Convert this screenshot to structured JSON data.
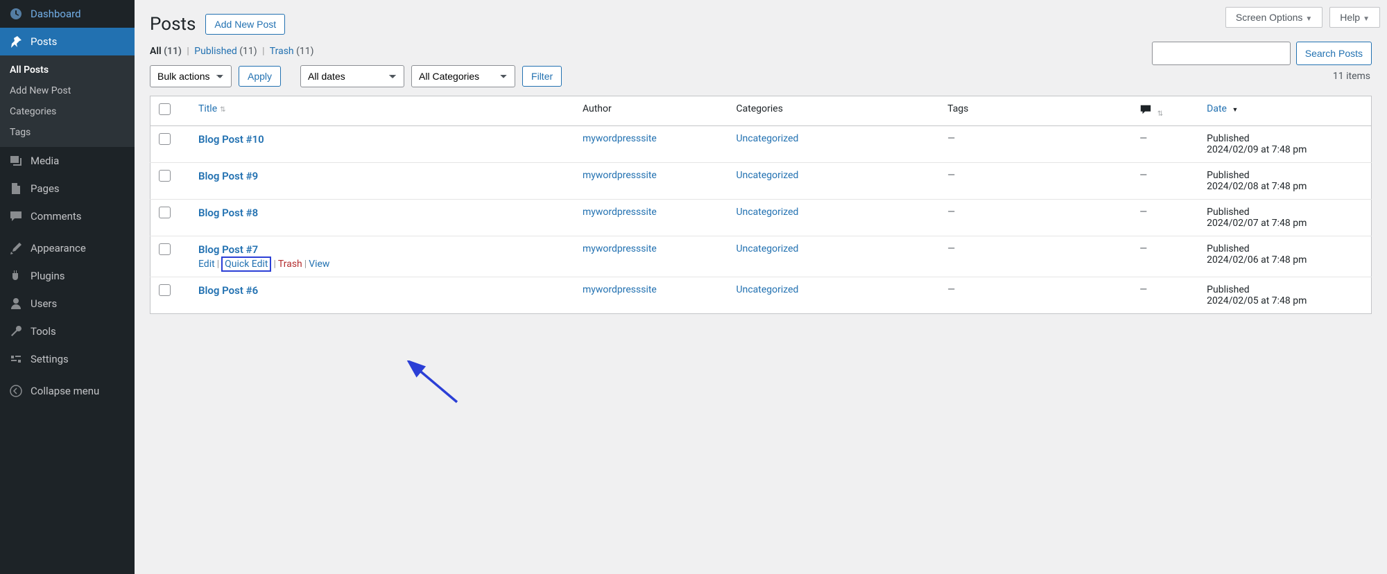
{
  "sidebar": {
    "items": [
      {
        "label": "Dashboard",
        "icon": "dashboard"
      },
      {
        "label": "Posts",
        "icon": "pin",
        "active": true
      },
      {
        "label": "Media",
        "icon": "media"
      },
      {
        "label": "Pages",
        "icon": "page"
      },
      {
        "label": "Comments",
        "icon": "comment"
      },
      {
        "label": "Appearance",
        "icon": "brush"
      },
      {
        "label": "Plugins",
        "icon": "plugin"
      },
      {
        "label": "Users",
        "icon": "user"
      },
      {
        "label": "Tools",
        "icon": "wrench"
      },
      {
        "label": "Settings",
        "icon": "settings"
      },
      {
        "label": "Collapse menu",
        "icon": "collapse"
      }
    ],
    "sub": [
      "All Posts",
      "Add New Post",
      "Categories",
      "Tags"
    ]
  },
  "topbar": {
    "screen_options": "Screen Options",
    "help": "Help"
  },
  "header": {
    "title": "Posts",
    "add_new": "Add New Post"
  },
  "subsub": {
    "all_label": "All",
    "all_count": "(11)",
    "pub_label": "Published",
    "pub_count": "(11)",
    "trash_label": "Trash",
    "trash_count": "(11)"
  },
  "controls": {
    "bulk": "Bulk actions",
    "apply": "Apply",
    "dates": "All dates",
    "cats": "All Categories",
    "filter": "Filter",
    "item_count": "11 items",
    "search": "Search Posts"
  },
  "columns": {
    "title": "Title",
    "author": "Author",
    "categories": "Categories",
    "tags": "Tags",
    "date": "Date"
  },
  "rows": [
    {
      "title": "Blog Post #10",
      "author": "mywordpresssite",
      "cat": "Uncategorized",
      "tags": "—",
      "com": "—",
      "date_status": "Published",
      "date": "2024/02/09 at 7:48 pm"
    },
    {
      "title": "Blog Post #9",
      "author": "mywordpresssite",
      "cat": "Uncategorized",
      "tags": "—",
      "com": "—",
      "date_status": "Published",
      "date": "2024/02/08 at 7:48 pm"
    },
    {
      "title": "Blog Post #8",
      "author": "mywordpresssite",
      "cat": "Uncategorized",
      "tags": "—",
      "com": "—",
      "date_status": "Published",
      "date": "2024/02/07 at 7:48 pm"
    },
    {
      "title": "Blog Post #7",
      "author": "mywordpresssite",
      "cat": "Uncategorized",
      "tags": "—",
      "com": "—",
      "date_status": "Published",
      "date": "2024/02/06 at 7:48 pm",
      "hover": true
    },
    {
      "title": "Blog Post #6",
      "author": "mywordpresssite",
      "cat": "Uncategorized",
      "tags": "—",
      "com": "—",
      "date_status": "Published",
      "date": "2024/02/05 at 7:48 pm"
    }
  ],
  "row_actions": {
    "edit": "Edit",
    "quick_edit": "Quick Edit",
    "trash": "Trash",
    "view": "View"
  }
}
